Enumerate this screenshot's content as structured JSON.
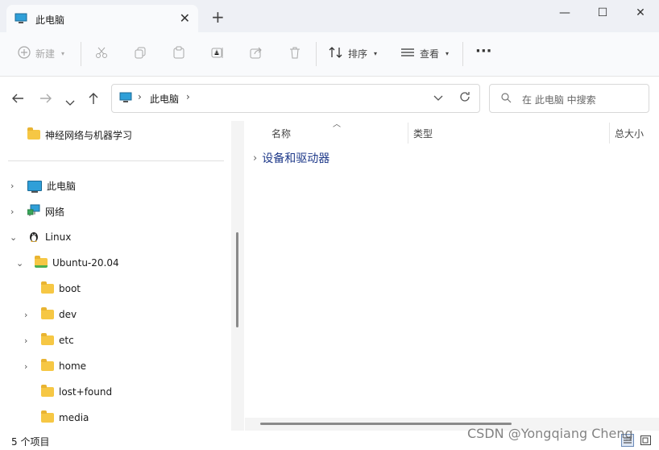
{
  "window": {
    "tab_title": "此电脑",
    "tab_close": "✕",
    "new_tab": "+",
    "minimize": "—",
    "maximize": "☐",
    "close": "✕"
  },
  "toolbar": {
    "new_label": "新建",
    "sort_label": "排序",
    "view_label": "查看",
    "more_label": "···"
  },
  "nav": {
    "address_parts": [
      "此电脑"
    ],
    "search_placeholder": "在 此电脑 中搜索"
  },
  "sidebar": {
    "quick_access": [
      {
        "label": "神经网络与机器学习",
        "icon": "folder-icon"
      }
    ],
    "tree": [
      {
        "label": "此电脑",
        "icon": "computer-icon",
        "expanded": false
      },
      {
        "label": "网络",
        "icon": "network-icon",
        "expanded": false
      },
      {
        "label": "Linux",
        "icon": "linux-penguin-icon",
        "expanded": true
      },
      {
        "label": "Ubuntu-20.04",
        "icon": "folder-icon",
        "expanded": true
      },
      {
        "label": "boot",
        "icon": "folder-icon"
      },
      {
        "label": "dev",
        "icon": "folder-icon",
        "expandable": true
      },
      {
        "label": "etc",
        "icon": "folder-icon",
        "expandable": true
      },
      {
        "label": "home",
        "icon": "folder-icon",
        "expandable": true
      },
      {
        "label": "lost+found",
        "icon": "folder-icon"
      },
      {
        "label": "media",
        "icon": "folder-icon"
      }
    ]
  },
  "content": {
    "columns": [
      "名称",
      "类型",
      "总大小"
    ],
    "groups": [
      {
        "label": "设备和驱动器",
        "expanded": false
      }
    ]
  },
  "status": {
    "item_count": "5 个项目"
  },
  "watermark": "CSDN @Yongqiang Cheng",
  "colors": {
    "titlebar_bg": "#eef0f5",
    "accent": "#2f9fd8",
    "group_text": "#1f3a8a"
  }
}
